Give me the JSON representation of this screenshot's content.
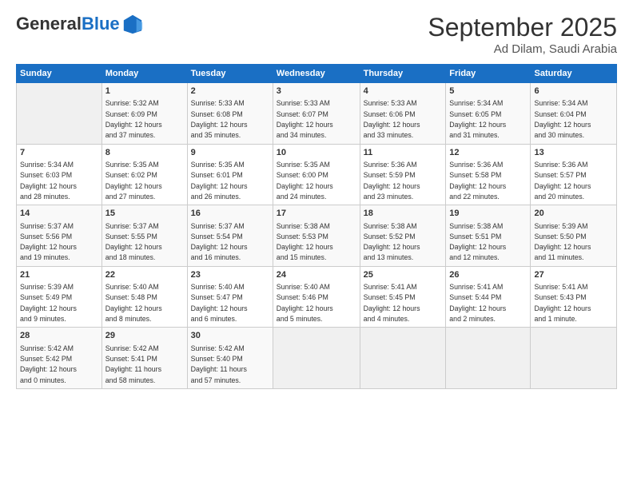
{
  "header": {
    "logo": {
      "general": "General",
      "blue": "Blue"
    },
    "title": "September 2025",
    "location": "Ad Dilam, Saudi Arabia"
  },
  "days_of_week": [
    "Sunday",
    "Monday",
    "Tuesday",
    "Wednesday",
    "Thursday",
    "Friday",
    "Saturday"
  ],
  "weeks": [
    [
      {
        "day": "",
        "info": ""
      },
      {
        "day": "1",
        "info": "Sunrise: 5:32 AM\nSunset: 6:09 PM\nDaylight: 12 hours\nand 37 minutes."
      },
      {
        "day": "2",
        "info": "Sunrise: 5:33 AM\nSunset: 6:08 PM\nDaylight: 12 hours\nand 35 minutes."
      },
      {
        "day": "3",
        "info": "Sunrise: 5:33 AM\nSunset: 6:07 PM\nDaylight: 12 hours\nand 34 minutes."
      },
      {
        "day": "4",
        "info": "Sunrise: 5:33 AM\nSunset: 6:06 PM\nDaylight: 12 hours\nand 33 minutes."
      },
      {
        "day": "5",
        "info": "Sunrise: 5:34 AM\nSunset: 6:05 PM\nDaylight: 12 hours\nand 31 minutes."
      },
      {
        "day": "6",
        "info": "Sunrise: 5:34 AM\nSunset: 6:04 PM\nDaylight: 12 hours\nand 30 minutes."
      }
    ],
    [
      {
        "day": "7",
        "info": "Sunrise: 5:34 AM\nSunset: 6:03 PM\nDaylight: 12 hours\nand 28 minutes."
      },
      {
        "day": "8",
        "info": "Sunrise: 5:35 AM\nSunset: 6:02 PM\nDaylight: 12 hours\nand 27 minutes."
      },
      {
        "day": "9",
        "info": "Sunrise: 5:35 AM\nSunset: 6:01 PM\nDaylight: 12 hours\nand 26 minutes."
      },
      {
        "day": "10",
        "info": "Sunrise: 5:35 AM\nSunset: 6:00 PM\nDaylight: 12 hours\nand 24 minutes."
      },
      {
        "day": "11",
        "info": "Sunrise: 5:36 AM\nSunset: 5:59 PM\nDaylight: 12 hours\nand 23 minutes."
      },
      {
        "day": "12",
        "info": "Sunrise: 5:36 AM\nSunset: 5:58 PM\nDaylight: 12 hours\nand 22 minutes."
      },
      {
        "day": "13",
        "info": "Sunrise: 5:36 AM\nSunset: 5:57 PM\nDaylight: 12 hours\nand 20 minutes."
      }
    ],
    [
      {
        "day": "14",
        "info": "Sunrise: 5:37 AM\nSunset: 5:56 PM\nDaylight: 12 hours\nand 19 minutes."
      },
      {
        "day": "15",
        "info": "Sunrise: 5:37 AM\nSunset: 5:55 PM\nDaylight: 12 hours\nand 18 minutes."
      },
      {
        "day": "16",
        "info": "Sunrise: 5:37 AM\nSunset: 5:54 PM\nDaylight: 12 hours\nand 16 minutes."
      },
      {
        "day": "17",
        "info": "Sunrise: 5:38 AM\nSunset: 5:53 PM\nDaylight: 12 hours\nand 15 minutes."
      },
      {
        "day": "18",
        "info": "Sunrise: 5:38 AM\nSunset: 5:52 PM\nDaylight: 12 hours\nand 13 minutes."
      },
      {
        "day": "19",
        "info": "Sunrise: 5:38 AM\nSunset: 5:51 PM\nDaylight: 12 hours\nand 12 minutes."
      },
      {
        "day": "20",
        "info": "Sunrise: 5:39 AM\nSunset: 5:50 PM\nDaylight: 12 hours\nand 11 minutes."
      }
    ],
    [
      {
        "day": "21",
        "info": "Sunrise: 5:39 AM\nSunset: 5:49 PM\nDaylight: 12 hours\nand 9 minutes."
      },
      {
        "day": "22",
        "info": "Sunrise: 5:40 AM\nSunset: 5:48 PM\nDaylight: 12 hours\nand 8 minutes."
      },
      {
        "day": "23",
        "info": "Sunrise: 5:40 AM\nSunset: 5:47 PM\nDaylight: 12 hours\nand 6 minutes."
      },
      {
        "day": "24",
        "info": "Sunrise: 5:40 AM\nSunset: 5:46 PM\nDaylight: 12 hours\nand 5 minutes."
      },
      {
        "day": "25",
        "info": "Sunrise: 5:41 AM\nSunset: 5:45 PM\nDaylight: 12 hours\nand 4 minutes."
      },
      {
        "day": "26",
        "info": "Sunrise: 5:41 AM\nSunset: 5:44 PM\nDaylight: 12 hours\nand 2 minutes."
      },
      {
        "day": "27",
        "info": "Sunrise: 5:41 AM\nSunset: 5:43 PM\nDaylight: 12 hours\nand 1 minute."
      }
    ],
    [
      {
        "day": "28",
        "info": "Sunrise: 5:42 AM\nSunset: 5:42 PM\nDaylight: 12 hours\nand 0 minutes."
      },
      {
        "day": "29",
        "info": "Sunrise: 5:42 AM\nSunset: 5:41 PM\nDaylight: 11 hours\nand 58 minutes."
      },
      {
        "day": "30",
        "info": "Sunrise: 5:42 AM\nSunset: 5:40 PM\nDaylight: 11 hours\nand 57 minutes."
      },
      {
        "day": "",
        "info": ""
      },
      {
        "day": "",
        "info": ""
      },
      {
        "day": "",
        "info": ""
      },
      {
        "day": "",
        "info": ""
      }
    ]
  ]
}
